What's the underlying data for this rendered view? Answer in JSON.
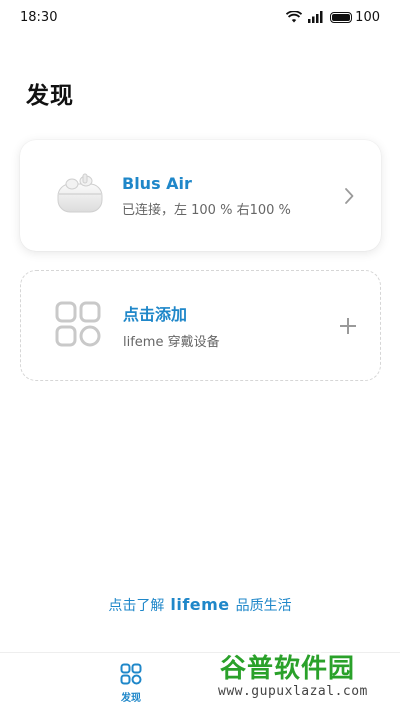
{
  "status_bar": {
    "time": "18:30",
    "battery": "100",
    "icons": [
      "wifi-icon",
      "cellular-signal-icon",
      "battery-icon"
    ]
  },
  "page": {
    "title": "发现"
  },
  "device_card": {
    "name": "Blus Air",
    "status": "已连接，左 100 % 右100 %",
    "icon": "earbuds-case-icon",
    "action_icon": "chevron-right-icon"
  },
  "add_card": {
    "title": "点击添加",
    "subtitle": "lifeme 穿戴设备",
    "icon": "add-device-grid-icon",
    "action_icon": "plus-icon"
  },
  "promo": {
    "prefix": "点击了解",
    "brand": "lifeme",
    "suffix": "品质生活"
  },
  "bottom_nav": {
    "items": [
      {
        "label": "发现",
        "icon": "discover-grid-icon",
        "active": true
      }
    ]
  },
  "watermark": {
    "title": "谷普软件园",
    "url": "www.gupuxlazal.com"
  },
  "colors": {
    "accent": "#1f87c9",
    "text_primary": "#111111",
    "text_secondary": "#666666",
    "watermark_green": "#2aa12a"
  }
}
